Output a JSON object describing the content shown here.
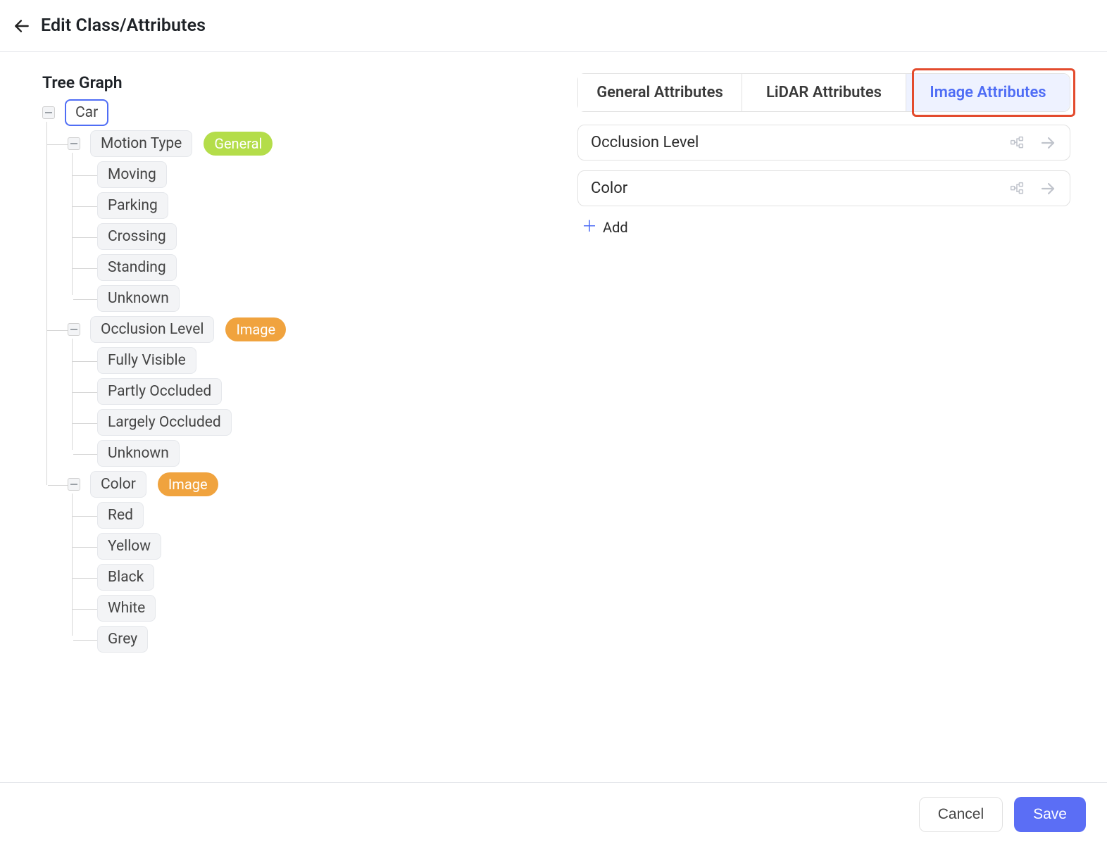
{
  "header": {
    "title": "Edit Class/Attributes"
  },
  "tree": {
    "title": "Tree Graph",
    "root": "Car",
    "groups": [
      {
        "label": "Motion Type",
        "badge": "General",
        "badgeClass": "general",
        "children": [
          "Moving",
          "Parking",
          "Crossing",
          "Standing",
          "Unknown"
        ]
      },
      {
        "label": "Occlusion Level",
        "badge": "Image",
        "badgeClass": "image",
        "children": [
          "Fully Visible",
          "Partly Occluded",
          "Largely Occluded",
          "Unknown"
        ]
      },
      {
        "label": "Color",
        "badge": "Image",
        "badgeClass": "image",
        "children": [
          "Red",
          "Yellow",
          "Black",
          "White",
          "Grey"
        ]
      }
    ]
  },
  "right": {
    "tabs": [
      {
        "label": "General Attributes",
        "active": false
      },
      {
        "label": "LiDAR Attributes",
        "active": false
      },
      {
        "label": "Image Attributes",
        "active": true
      }
    ],
    "attributes": [
      {
        "name": "Occlusion Level"
      },
      {
        "name": "Color"
      }
    ],
    "addLabel": "Add"
  },
  "footer": {
    "cancel": "Cancel",
    "save": "Save"
  }
}
